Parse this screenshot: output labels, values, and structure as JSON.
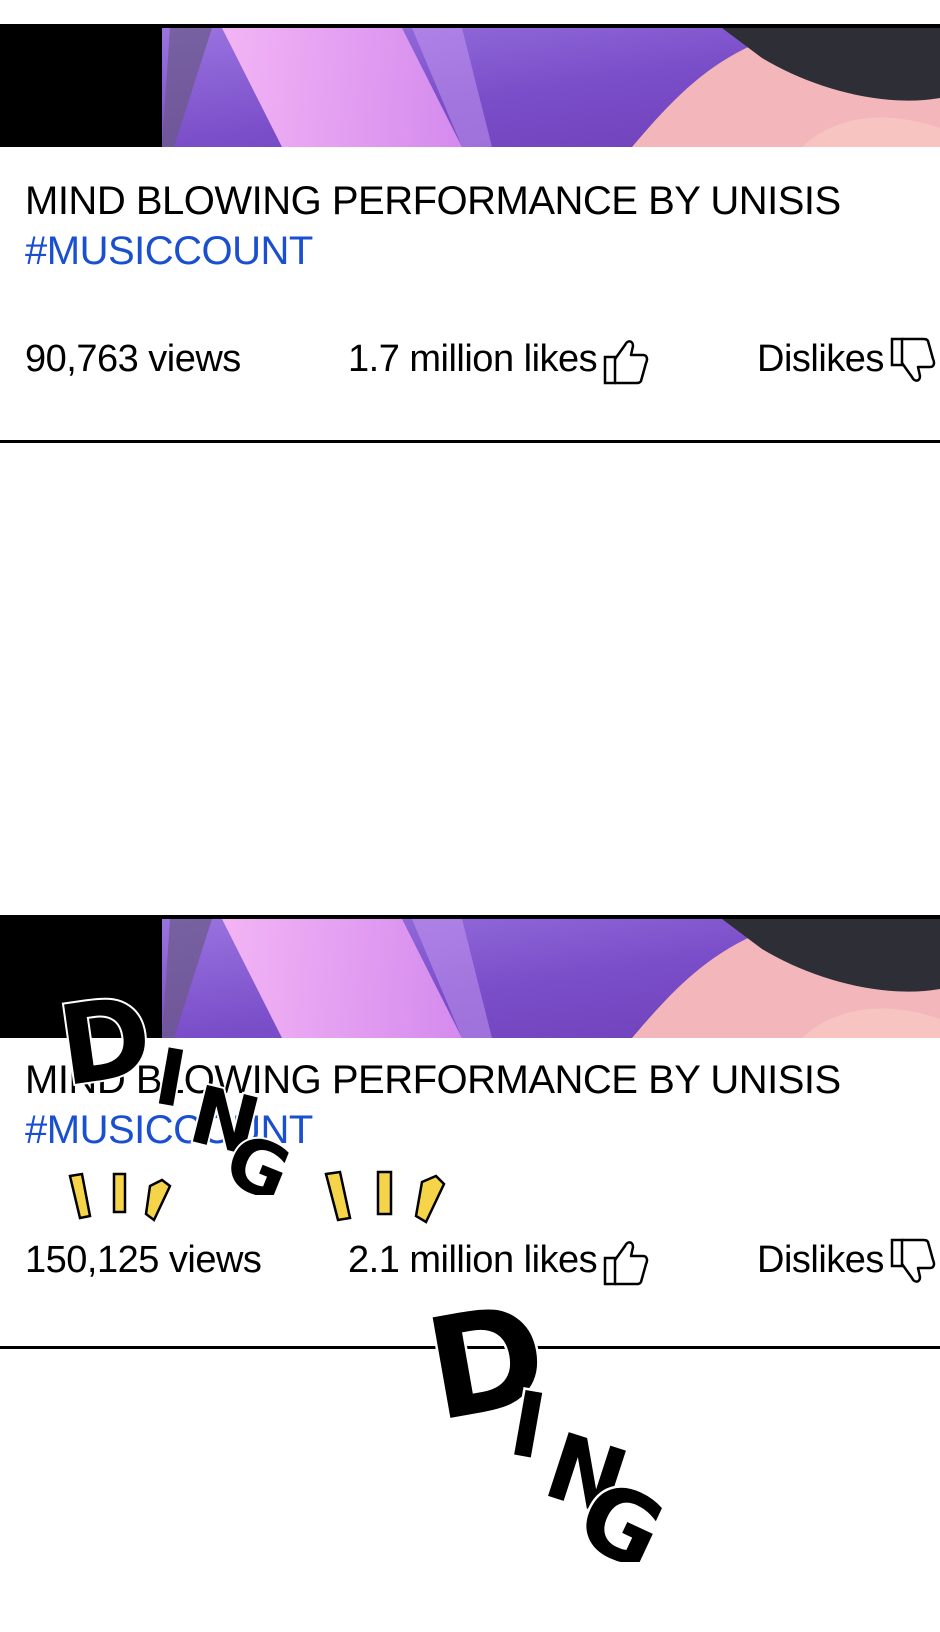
{
  "posts": [
    {
      "title": "MIND BLOWING PERFORMANCE BY UNISIS",
      "hashtag": "#MUSICCOUNT",
      "views": "90,763 views",
      "likes": "1.7 million likes",
      "dislikes": "Dislikes"
    },
    {
      "title": "MIND BLOWING PERFORMANCE BY UNISIS",
      "hashtag": "#MUSICCOUNT",
      "views": "150,125 views",
      "likes": "2.1 million likes",
      "dislikes": "Dislikes"
    }
  ],
  "sound_effects": [
    "DING",
    "DING"
  ],
  "colors": {
    "hashtag": "#1a4fd0",
    "thumbnail_purple": "#7a4fc9",
    "sfx_accent": "#f5d44a"
  },
  "icons": [
    "thumbs-up-icon",
    "thumbs-down-icon"
  ]
}
